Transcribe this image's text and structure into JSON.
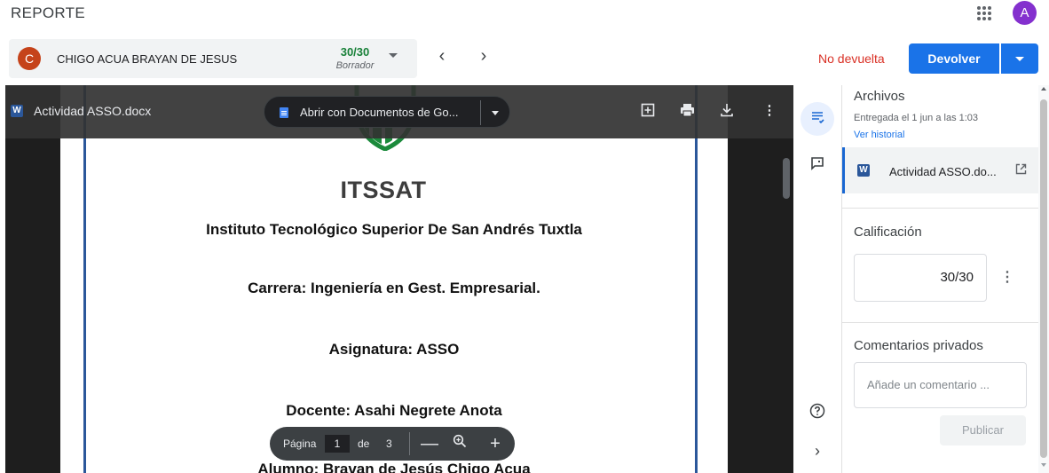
{
  "app": {
    "title": "REPORTE",
    "account_initial": "A",
    "apps_icon": "apps-grid-icon"
  },
  "student": {
    "initial": "C",
    "name": "CHIGO ACUA BRAYAN DE JESUS",
    "grade": "30/30",
    "grade_status": "Borrador"
  },
  "navigation": {
    "prev": "‹",
    "next": "›"
  },
  "actions": {
    "return_status": "No devuelta",
    "return_label": "Devolver"
  },
  "viewer": {
    "file_badge": "W",
    "file_name": "Actividad ASSO.docx",
    "open_with_label": "Abrir con Documentos de Go...",
    "icons": [
      "add-comment-icon",
      "print-icon",
      "download-icon",
      "more-vert-icon"
    ],
    "document": {
      "logo_text": "ITSSAT",
      "lines": [
        "Instituto Tecnológico Superior De San Andrés Tuxtla",
        "Carrera: Ingeniería en Gest. Empresarial.",
        "Asignatura: ASSO",
        "Docente: Asahi Negrete Anota",
        "Alumno: Bravan de Jesús Chigo Acua"
      ]
    },
    "page_controls": {
      "page_label": "Página",
      "current_page": "1",
      "of_label": "de",
      "total_pages": "3"
    }
  },
  "panel": {
    "files_title": "Archivos",
    "submitted_text": "Entregada el 1 jun a las 1:03",
    "history_link": "Ver historial",
    "attachment": {
      "badge": "W",
      "name": "Actividad ASSO.do..."
    },
    "grade_title": "Calificación",
    "grade_value": "30/30",
    "comments_title": "Comentarios privados",
    "comment_placeholder": "Añade un comentario ...",
    "publish_label": "Publicar"
  },
  "colors": {
    "accent": "#1a73e8",
    "danger": "#d93025",
    "grade_green": "#188038",
    "student_avatar": "#c5431a",
    "account_avatar": "#8430ce",
    "word_blue": "#2b579a"
  }
}
